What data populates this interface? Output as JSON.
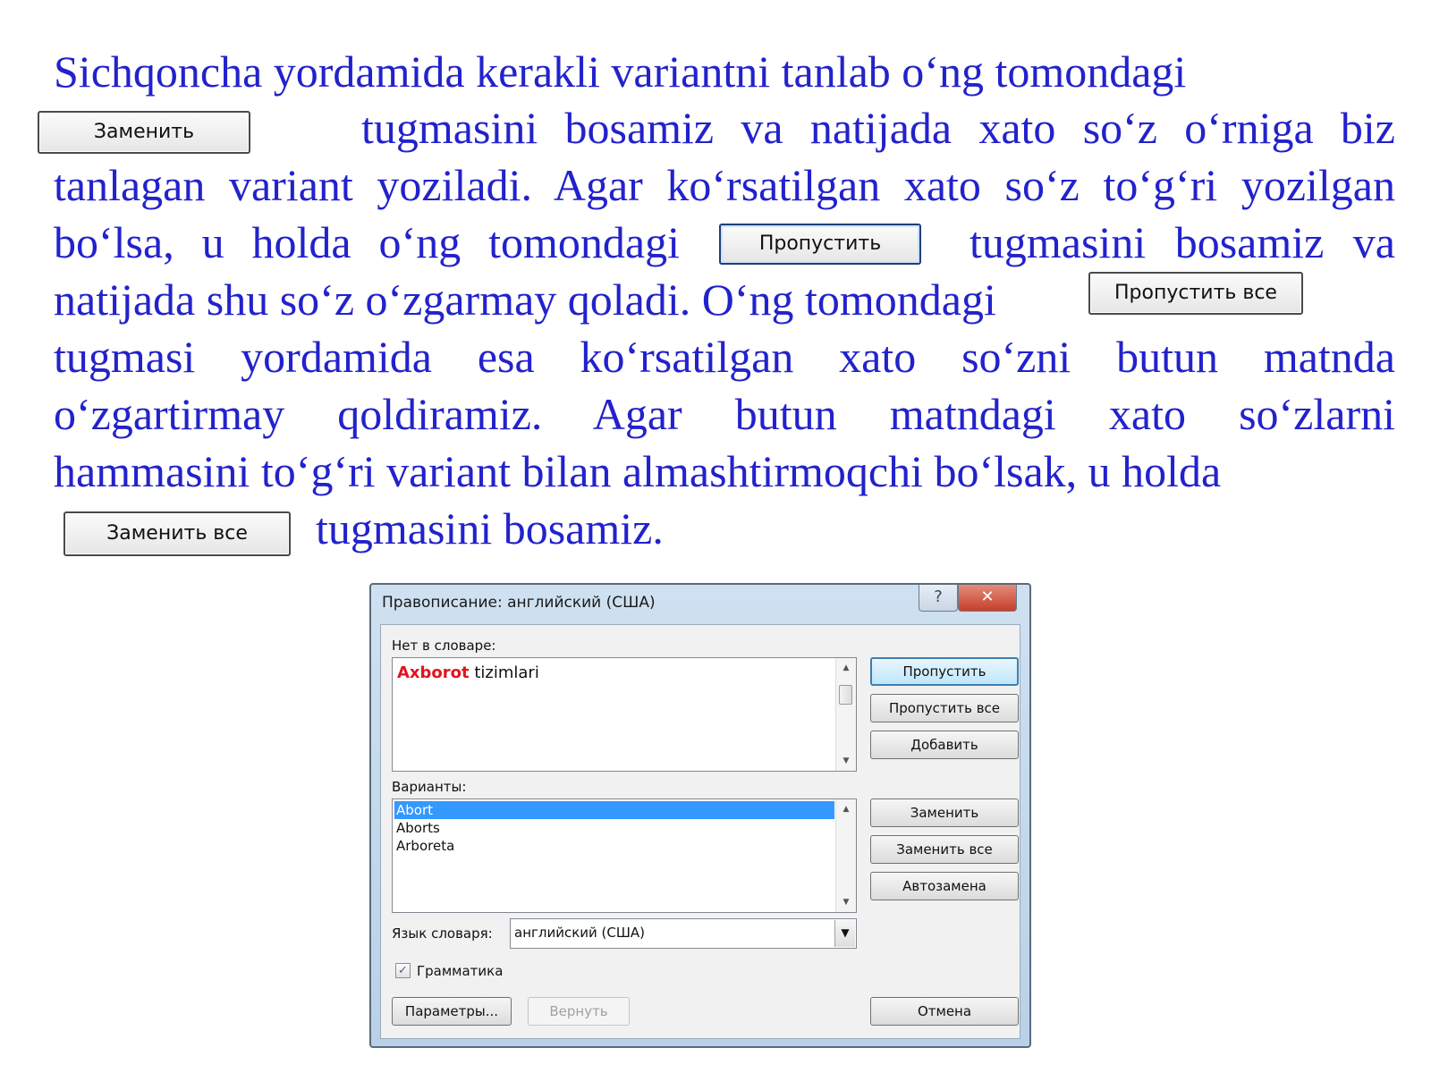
{
  "colors": {
    "text": "#2222cc",
    "error_word": "#e0141e",
    "selection": "#3399ff"
  },
  "paragraph": {
    "line1": "Sichqoncha yordamida kerakli variantni tanlab o‘ng tomondagi",
    "btn_replace": "Заменить",
    "line2": "tugmasini bosamiz va natijada xato so‘z o‘rniga biz",
    "line3": "tanlagan variant yoziladi. Agar ko‘rsatilgan xato so‘z to‘g‘ri yozilgan",
    "line4_a": "bo‘lsa, u holda o‘ng tomondagi",
    "btn_skip": "Пропустить",
    "line4_b": "tugmasini bosamiz va",
    "line5_a": "natijada shu so‘z o‘zgarmay qoladi. O‘ng tomondagi",
    "btn_skip_all": "Пропустить все",
    "line6": "tugmasi yordamida esa ko‘rsatilgan xato so‘zni butun matnda",
    "line7": "o‘zgartirmay qoldiramiz. Agar butun matndagi xato so‘zlarni",
    "line8": "hammasini to‘g‘ri variant bilan almashtirmoqchi bo‘lsak, u holda",
    "btn_replace_all": "Заменить все",
    "line9": "tugmasini bosamiz."
  },
  "dialog": {
    "title": "Правописание: английский (США)",
    "help": "?",
    "close": "✕",
    "not_in_dict_label": "Нет в словаре:",
    "error_word": "Axborot",
    "error_rest": " tizimlari",
    "variants_label": "Варианты:",
    "variants": [
      "Abort",
      "Aborts",
      "Arboreta"
    ],
    "dict_lang_label": "Язык словаря:",
    "dict_lang_value": "английский (США)",
    "grammar_label": "Грамматика",
    "grammar_checked": true,
    "buttons": {
      "skip": "Пропустить",
      "skip_all": "Пропустить все",
      "add": "Добавить",
      "replace": "Заменить",
      "replace_all": "Заменить все",
      "autocorrect": "Автозамена",
      "options": "Параметры...",
      "undo": "Вернуть",
      "cancel": "Отмена"
    },
    "icons": {
      "scroll_up": "▲",
      "scroll_down": "▼",
      "combo_arrow": "▼",
      "check": "✓"
    }
  }
}
